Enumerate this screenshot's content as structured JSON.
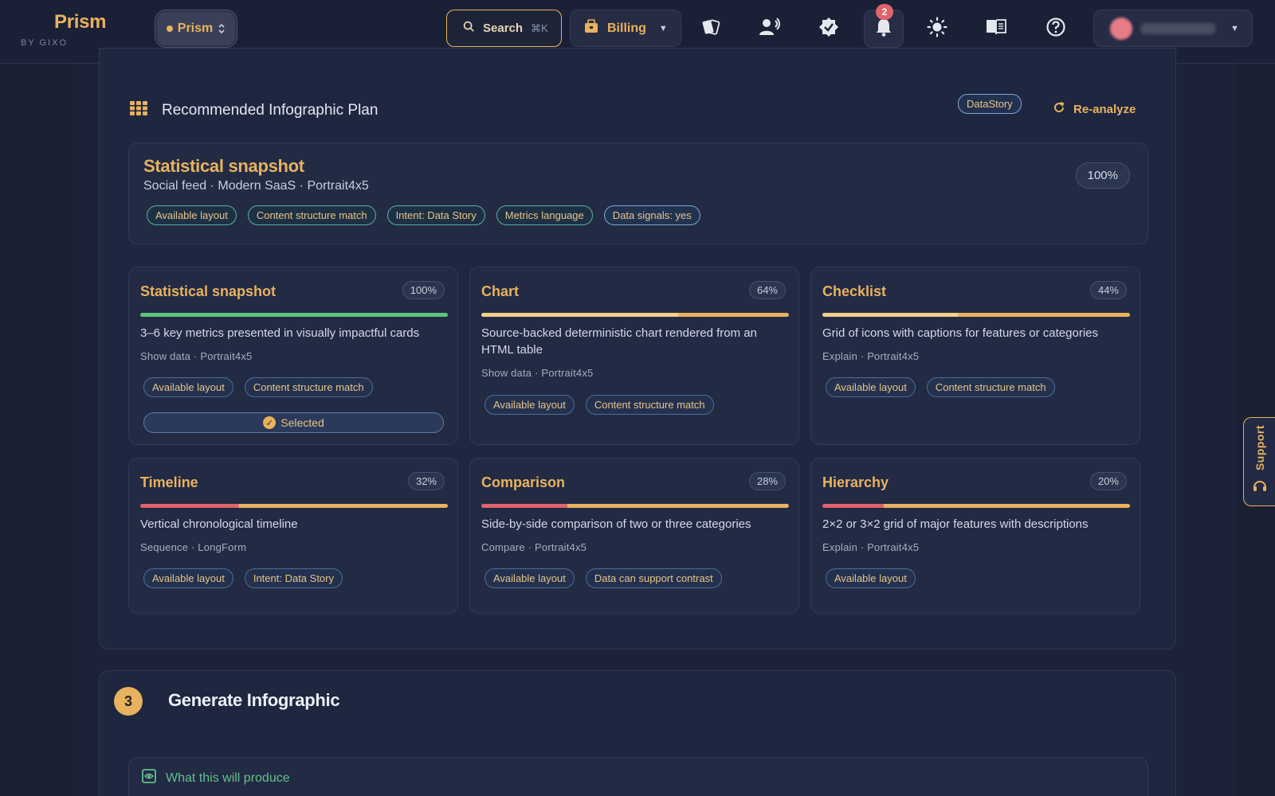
{
  "brand": {
    "name": "Prism",
    "sub": "BY GIXO"
  },
  "topbar": {
    "workspace": "Prism",
    "search_label": "Search",
    "search_shortcut": "⌘K",
    "billing_label": "Billing",
    "notifications_count": "2"
  },
  "plan": {
    "title": "Recommended Infographic Plan",
    "badge": "DataStory",
    "reanalyze_label": "Re-analyze",
    "hero": {
      "title": "Statistical snapshot",
      "subtitle": "Social feed · Modern SaaS · Portrait4x5",
      "score": "100%",
      "tags": [
        "Available layout",
        "Content structure match",
        "Intent: Data Story",
        "Metrics language",
        "Data signals: yes"
      ]
    },
    "cards": [
      {
        "title": "Statistical snapshot",
        "score": "100%",
        "fill": 1.0,
        "desc": "3–6 key metrics presented in visually impactful cards",
        "meta": "Show data · Portrait4x5",
        "tags": [
          "Available layout",
          "Content structure match"
        ],
        "selected_label": "Selected"
      },
      {
        "title": "Chart",
        "score": "64%",
        "fill": 0.64,
        "desc": "Source-backed deterministic chart rendered from an HTML table",
        "meta": "Show data · Portrait4x5",
        "tags": [
          "Available layout",
          "Content structure match"
        ]
      },
      {
        "title": "Checklist",
        "score": "44%",
        "fill": 0.44,
        "desc": "Grid of icons with captions for features or categories",
        "meta": "Explain · Portrait4x5",
        "tags": [
          "Available layout",
          "Content structure match"
        ]
      },
      {
        "title": "Timeline",
        "score": "32%",
        "fill": 0.32,
        "desc": "Vertical chronological timeline",
        "meta": "Sequence · LongForm",
        "tags": [
          "Available layout",
          "Intent: Data Story"
        ]
      },
      {
        "title": "Comparison",
        "score": "28%",
        "fill": 0.28,
        "desc": "Side-by-side comparison of two or three categories",
        "meta": "Compare · Portrait4x5",
        "tags": [
          "Available layout",
          "Data can support contrast"
        ]
      },
      {
        "title": "Hierarchy",
        "score": "20%",
        "fill": 0.2,
        "desc": "2×2 or 3×2 grid of major features with descriptions",
        "meta": "Explain · Portrait4x5",
        "tags": [
          "Available layout"
        ]
      }
    ]
  },
  "generate": {
    "step": "3",
    "title": "Generate Infographic",
    "produce_label": "What this will produce"
  },
  "support": {
    "label": "Support"
  },
  "colors": {
    "accent": "#e8b25e",
    "success": "#62c08a",
    "danger": "#e0636b",
    "green_bar": "#5ec47c",
    "red_bar": "#e0636b"
  }
}
